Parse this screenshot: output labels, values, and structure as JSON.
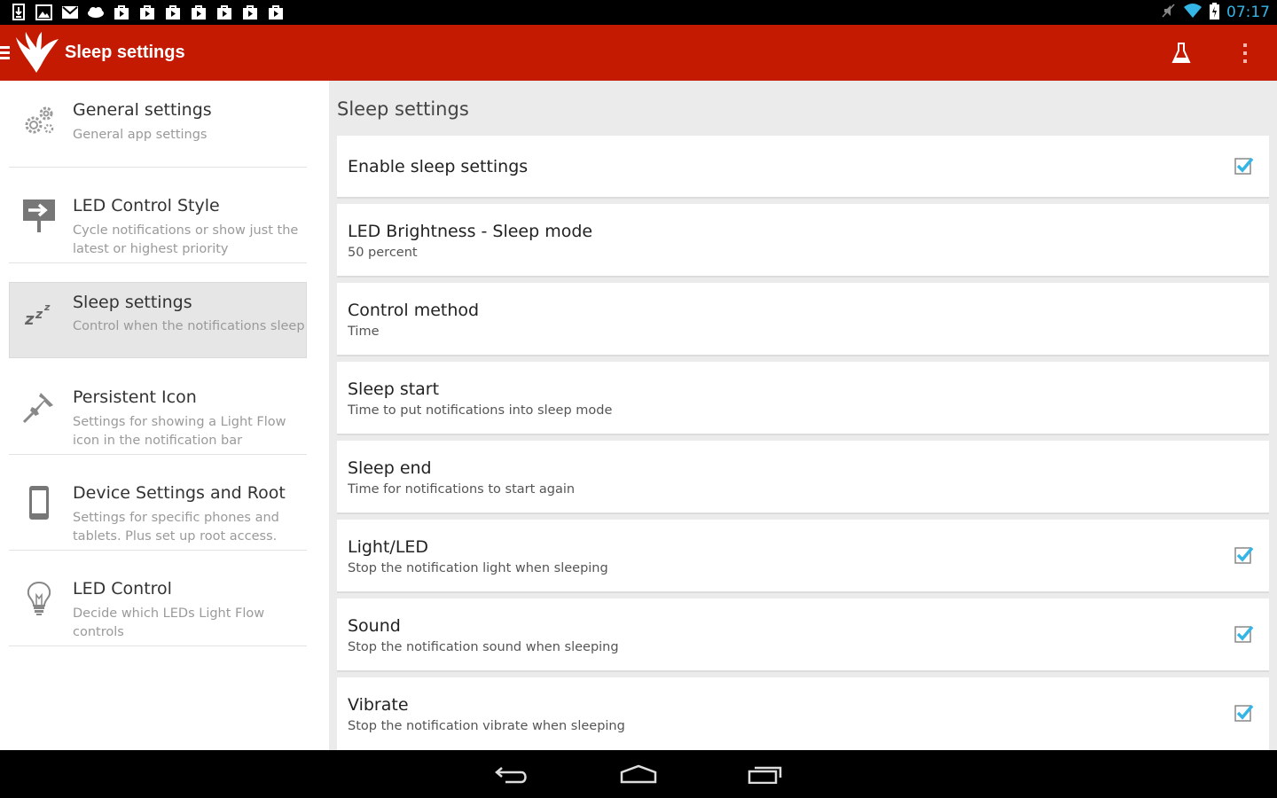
{
  "status_bar": {
    "clock": "07:17",
    "notification_icons": [
      "download-icon",
      "image-icon",
      "gmail-icon",
      "cloud-icon",
      "play-store-icon",
      "play-store-icon",
      "play-store-icon",
      "play-store-icon",
      "play-store-icon",
      "play-store-icon",
      "play-store-icon"
    ],
    "clock_color": "#33b5e5"
  },
  "action_bar": {
    "title": "Sleep settings",
    "color": "#c41a02"
  },
  "sidebar": {
    "items": [
      {
        "title": "General settings",
        "subtitle": "General app settings",
        "icon": "gears-icon"
      },
      {
        "title": "LED Control Style",
        "subtitle": "Cycle notifications or show just the latest or highest priority",
        "icon": "arrow-sign-icon"
      },
      {
        "title": "Sleep settings",
        "subtitle": "Control when the notifications sleep",
        "icon": "zzz-icon",
        "active": true
      },
      {
        "title": "Persistent Icon",
        "subtitle": "Settings for showing a Light Flow icon in the notification bar",
        "icon": "pushpin-icon"
      },
      {
        "title": "Device Settings and Root",
        "subtitle": "Settings for specific phones and tablets. Plus set up root access.",
        "icon": "phone-icon"
      },
      {
        "title": "LED Control",
        "subtitle": "Decide which LEDs Light Flow controls",
        "icon": "lightbulb-icon"
      }
    ]
  },
  "main": {
    "header": "Sleep settings",
    "preferences": [
      {
        "title": "Enable sleep settings",
        "summary": "",
        "checkbox": true,
        "checked": true
      },
      {
        "title": "LED Brightness - Sleep mode",
        "summary": "50 percent",
        "checkbox": false
      },
      {
        "title": "Control method",
        "summary": "Time",
        "checkbox": false
      },
      {
        "title": "Sleep start",
        "summary": "Time to put notifications into sleep mode",
        "checkbox": false
      },
      {
        "title": "Sleep end",
        "summary": "Time for notifications to start again",
        "checkbox": false
      },
      {
        "title": "Light/LED",
        "summary": "Stop the notification light when sleeping",
        "checkbox": true,
        "checked": true
      },
      {
        "title": "Sound",
        "summary": "Stop the notification sound when sleeping",
        "checkbox": true,
        "checked": true
      },
      {
        "title": "Vibrate",
        "summary": "Stop the notification vibrate when sleeping",
        "checkbox": true,
        "checked": true
      }
    ],
    "check_color": "#33b5e5"
  }
}
